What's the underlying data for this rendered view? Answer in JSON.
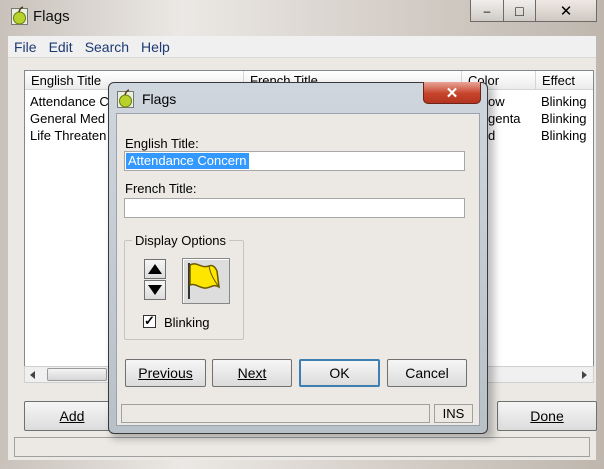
{
  "window": {
    "title": "Flags",
    "minimize_glyph": "–",
    "maximize_glyph": "□",
    "close_glyph": "✕"
  },
  "menu": [
    "File",
    "Edit",
    "Search",
    "Help"
  ],
  "list": {
    "columns": [
      "English Title",
      "French Title",
      "Color",
      "Effect"
    ],
    "rows": [
      {
        "english": "Attendance C",
        "color": "ow",
        "effect": "Blinking"
      },
      {
        "english": "General Med",
        "color": "genta",
        "effect": "Blinking"
      },
      {
        "english": "Life Threaten",
        "color": "d",
        "effect": "Blinking"
      }
    ]
  },
  "bottom_buttons": {
    "add": "Add",
    "done": "Done"
  },
  "dialog": {
    "title": "Flags",
    "close_glyph": "✕",
    "english_label": "English Title:",
    "english_value": "Attendance Concern",
    "french_label": "French Title:",
    "french_value": "",
    "group_label": "Display Options",
    "blinking_label": "Blinking",
    "blinking_checked": "✓",
    "buttons": {
      "previous": "Previous",
      "next": "Next",
      "ok": "OK",
      "cancel": "Cancel"
    },
    "status_mode": "INS"
  },
  "colors": {
    "selection": "#3399ff",
    "flag": "#ffe600",
    "close_button": "#c7442c",
    "menu_text": "#1d3a73"
  },
  "icons": {
    "app": "green-apple-icon",
    "flag": "yellow-flag-icon",
    "up": "arrow-up-icon",
    "down": "arrow-down-icon"
  }
}
